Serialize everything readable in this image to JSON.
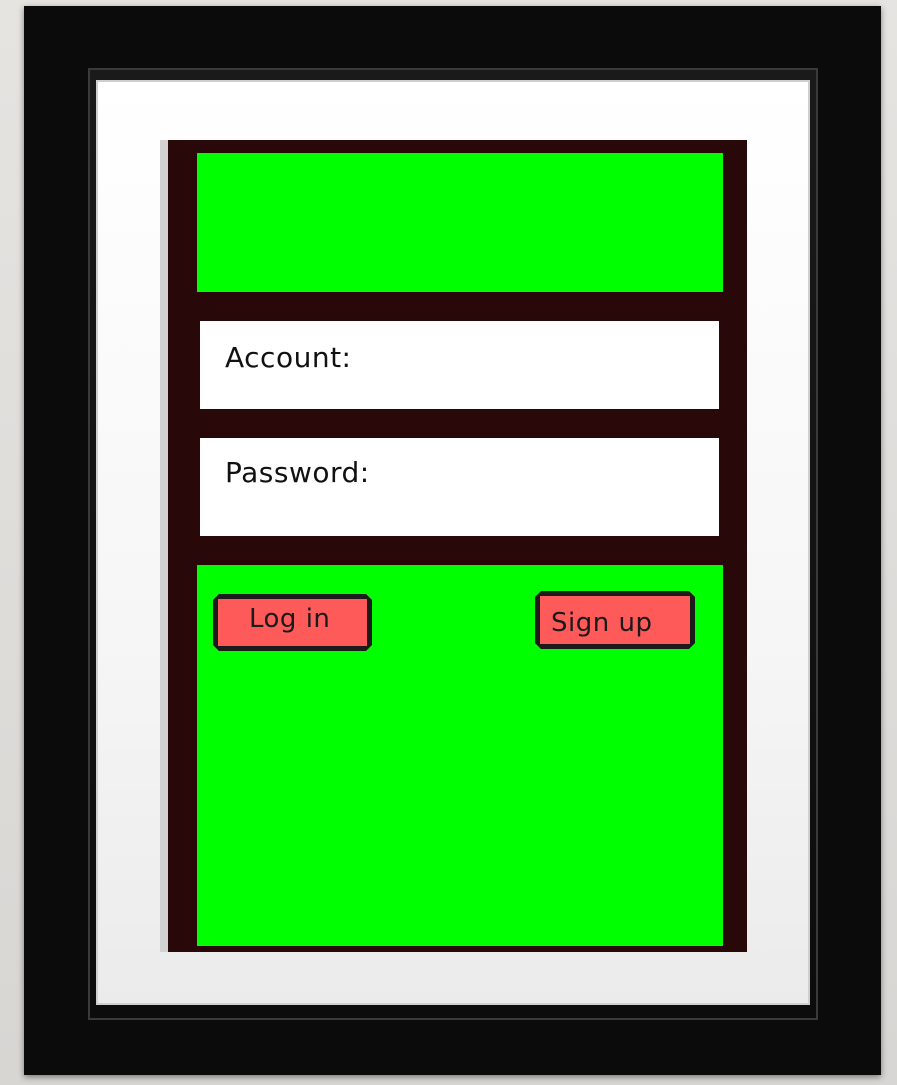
{
  "form": {
    "account_label": "Account:",
    "account_value": "",
    "password_label": "Password:",
    "password_value": ""
  },
  "buttons": {
    "login_label": "Log in",
    "signup_label": "Sign up"
  },
  "colors": {
    "panel": "#00ff00",
    "screen_background": "#280808",
    "button": "#ff5a5a",
    "frame": "#0b0b0b"
  }
}
